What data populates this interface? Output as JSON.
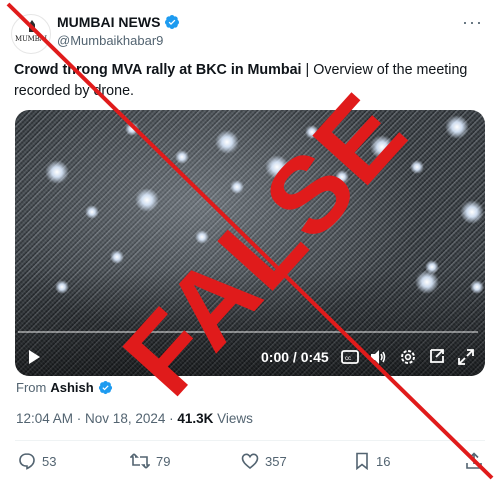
{
  "account": {
    "name": "MUMBAI NEWS",
    "handle": "@Mumbaikhabar9",
    "avatar_text": "MUMBAI",
    "more_label": "···"
  },
  "tweet": {
    "headline": "Crowd throng MVA rally at BKC in Mumbai",
    "separator": " | ",
    "body": "Overview of the meeting recorded by drone."
  },
  "video": {
    "time": "0:00 / 0:45",
    "progress_fraction": 0
  },
  "from": {
    "label": "From",
    "name": "Ashish"
  },
  "meta": {
    "time": "12:04 AM",
    "dot": " · ",
    "date": "Nov 18, 2024",
    "views_count": "41.3K",
    "views_label": "Views"
  },
  "actions": {
    "replies": "53",
    "reposts": "79",
    "likes": "357",
    "bookmarks": "16"
  },
  "overlay": {
    "stamp_text": "FALSE",
    "stamp_color": "#e01b1b"
  },
  "colors": {
    "verified": "#1d9bf0",
    "secondary_text": "#536471",
    "primary_text": "#0f1419"
  }
}
